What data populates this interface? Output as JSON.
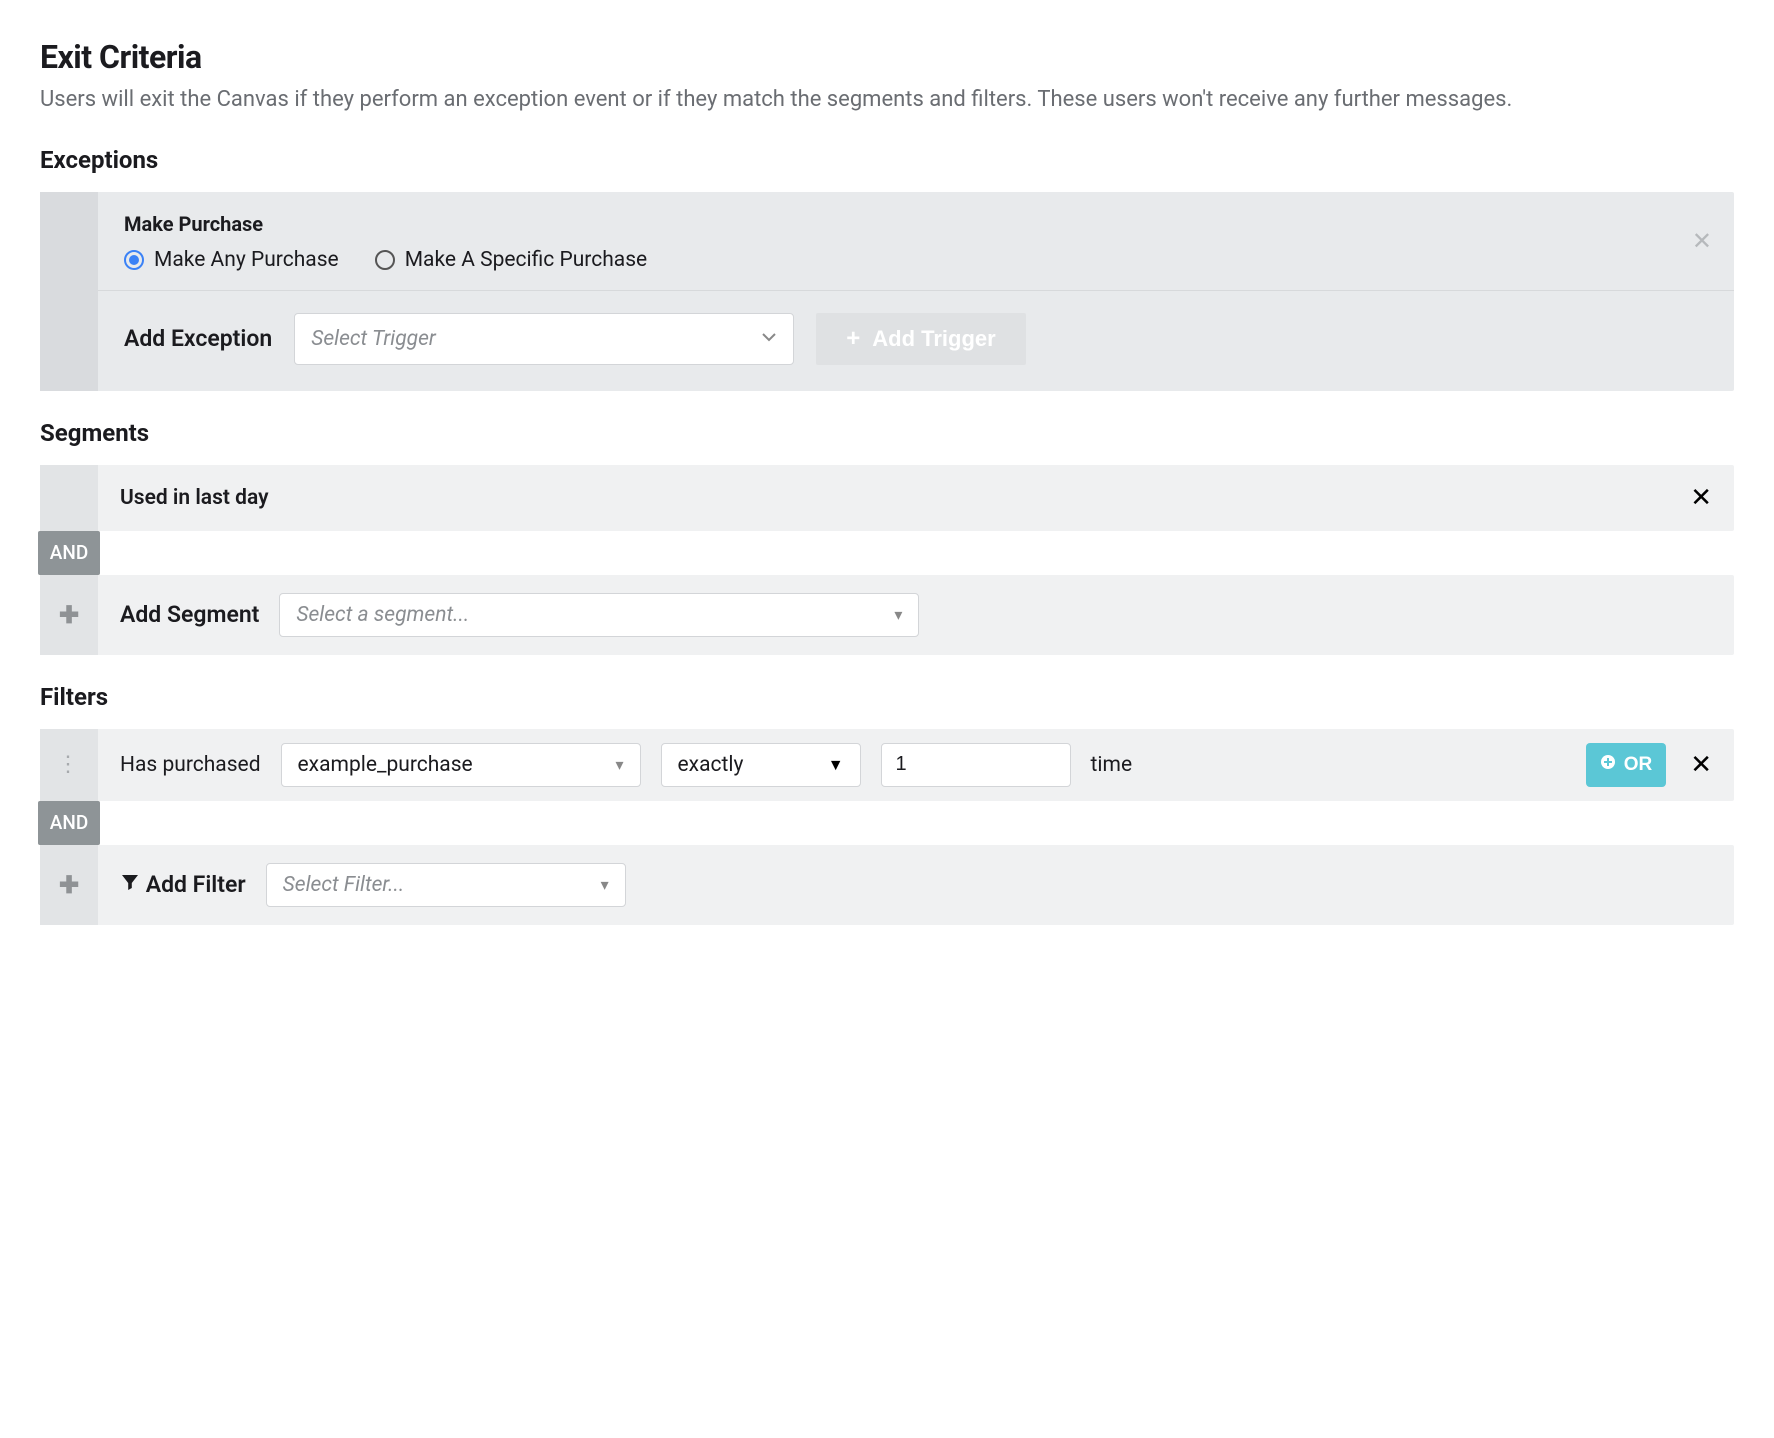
{
  "page": {
    "title": "Exit Criteria",
    "description": "Users will exit the Canvas if they perform an exception event or if they match the segments and filters. These users won't receive any further messages."
  },
  "exceptions": {
    "heading": "Exceptions",
    "block_title": "Make Purchase",
    "radio_any": "Make Any Purchase",
    "radio_specific": "Make A Specific Purchase",
    "add_exception_label": "Add Exception",
    "select_trigger_placeholder": "Select Trigger",
    "add_trigger_button": "Add Trigger"
  },
  "segments": {
    "heading": "Segments",
    "items": [
      {
        "label": "Used in last day"
      }
    ],
    "and_label": "AND",
    "add_segment_label": "Add Segment",
    "select_segment_placeholder": "Select a segment..."
  },
  "filters": {
    "heading": "Filters",
    "row": {
      "prefix": "Has purchased",
      "product": "example_purchase",
      "comparator": "exactly",
      "count": "1",
      "suffix": "time"
    },
    "or_label": "OR",
    "and_label": "AND",
    "add_filter_label": "Add Filter",
    "select_filter_placeholder": "Select Filter..."
  }
}
